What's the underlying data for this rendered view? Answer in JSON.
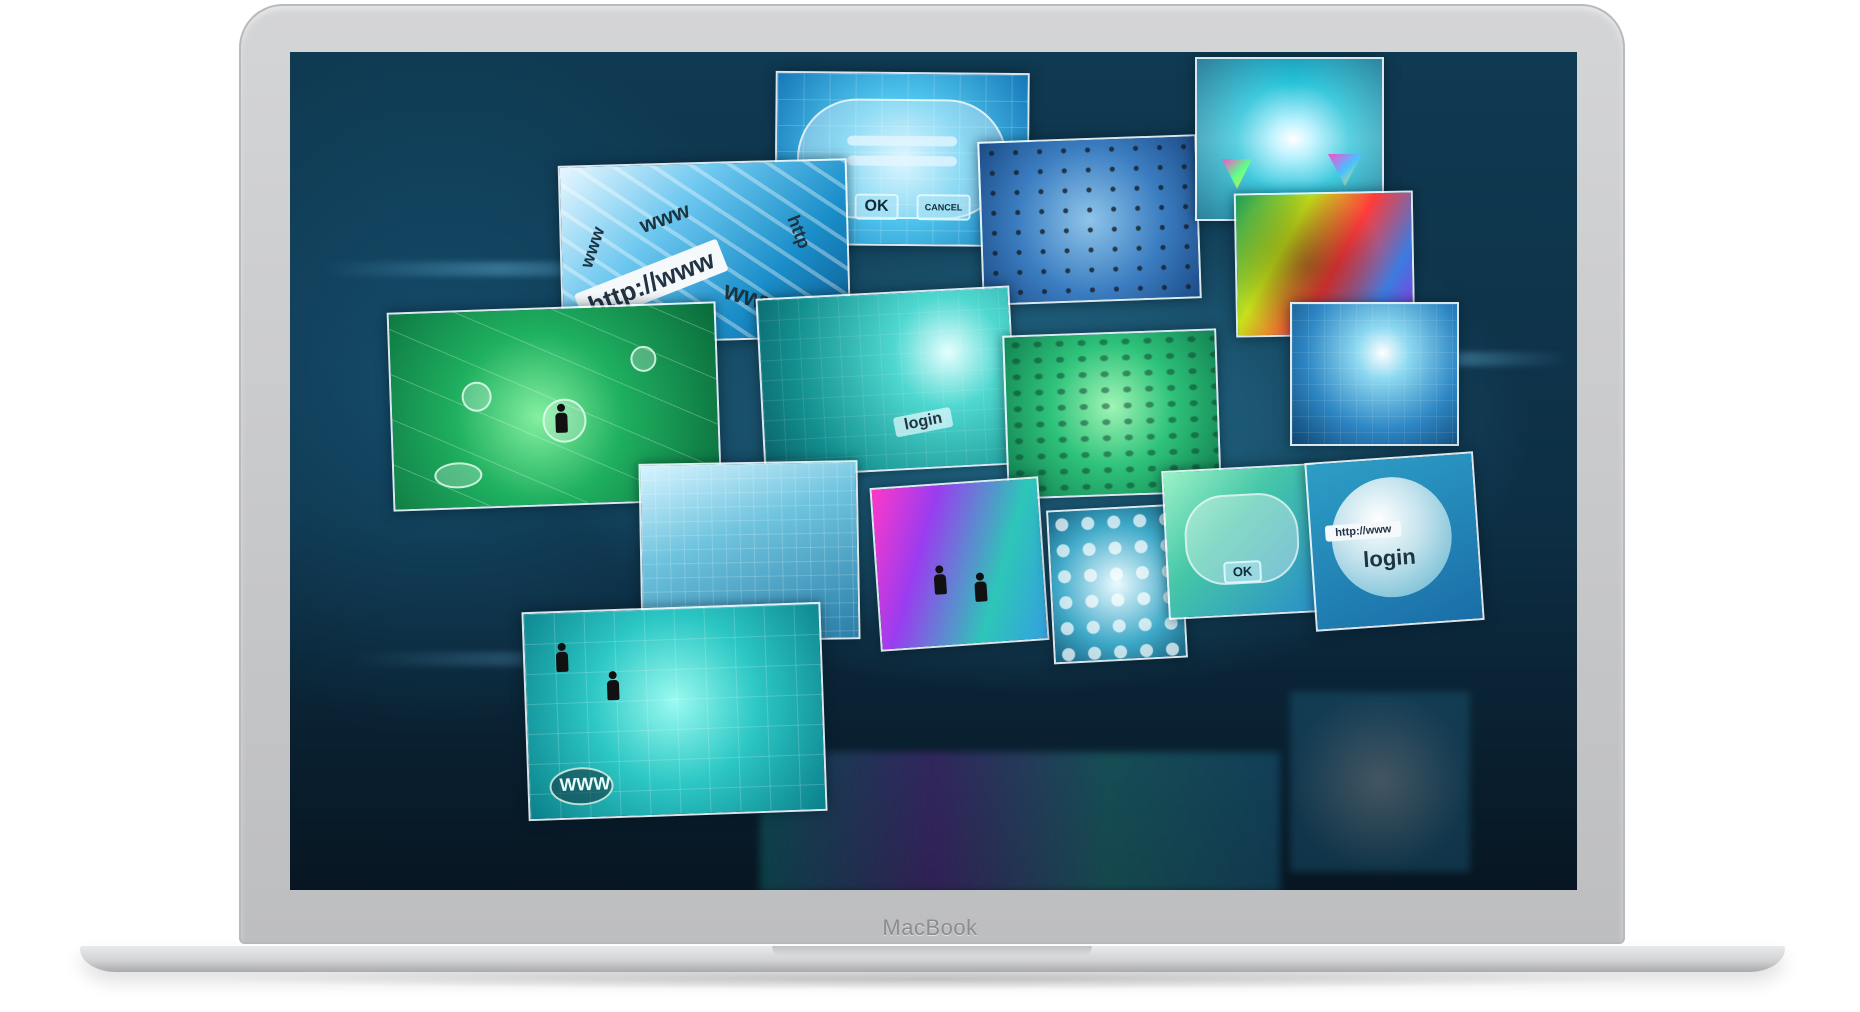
{
  "device": {
    "brand_label": "MacBook"
  },
  "panels": {
    "url_panel": {
      "url": "http://www",
      "url_words": [
        "www",
        "www",
        "http",
        "www"
      ]
    },
    "cloud_login": {
      "ok_label": "OK",
      "cancel_label": "CANCEL"
    },
    "cloud_login_2": {
      "ok_label": "OK"
    },
    "network_panel_1": {
      "tag": "WWW"
    },
    "login_globe": {
      "url": "http://www",
      "login": "login"
    },
    "teal_panel": {
      "login": "login"
    }
  },
  "colors": {
    "screen_dark": "#0c1f2d",
    "screen_glow": "#3caad2",
    "laptop_silver": "#c6c7c9",
    "panel_border": "#f0faff"
  }
}
